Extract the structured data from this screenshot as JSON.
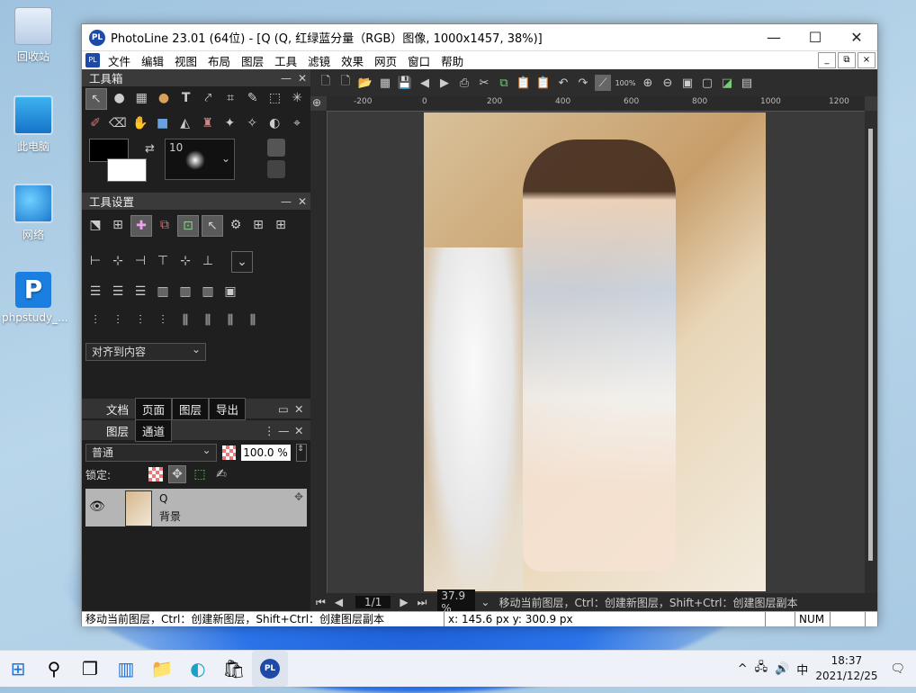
{
  "desktop": {
    "icons": [
      {
        "label": "回收站"
      },
      {
        "label": "此电脑"
      },
      {
        "label": "网络"
      },
      {
        "label": "phpstudy_..."
      }
    ]
  },
  "window": {
    "app_icon_text": "PL",
    "title": "PhotoLine 23.01 (64位) - [Q (Q, 红绿蓝分量（RGB）图像, 1000x1457, 38%)]",
    "controls": {
      "minimize": "—",
      "maximize": "☐",
      "close": "✕"
    }
  },
  "menu": {
    "items": [
      "文件",
      "编辑",
      "视图",
      "布局",
      "图层",
      "工具",
      "滤镜",
      "效果",
      "网页",
      "窗口",
      "帮助"
    ],
    "mdi": [
      "_",
      "⧉",
      "×"
    ]
  },
  "toolbox": {
    "title": "工具箱",
    "brush_size": "10"
  },
  "tool_settings": {
    "title": "工具设置",
    "align_select": "对齐到内容"
  },
  "doc_tabs": {
    "tabs": [
      "文档",
      "页面",
      "图层",
      "导出"
    ]
  },
  "layers_panel": {
    "tabs": [
      "图层",
      "通道"
    ],
    "blend_mode": "普通",
    "opacity": "100.0 %",
    "lock_label": "锁定:",
    "layer": {
      "name": "Q",
      "sub": "背景"
    }
  },
  "canvas": {
    "ruler_labels": [
      "-200",
      "0",
      "200",
      "400",
      "600",
      "800",
      "1000",
      "1200"
    ],
    "page_indicator": "1/1",
    "zoom": "37.9 %",
    "hint": "移动当前图层，Ctrl：创建新图层，Shift+Ctrl：创建图层副本"
  },
  "toolbar_zoom": "100%",
  "status": {
    "hint": "移动当前图层，Ctrl：创建新图层，Shift+Ctrl：创建图层副本",
    "coords": "x: 145.6 px y: 300.9 px",
    "num": "NUM"
  },
  "taskbar": {
    "tray_ime": "中",
    "time": "18:37",
    "date": "2021/12/25"
  }
}
